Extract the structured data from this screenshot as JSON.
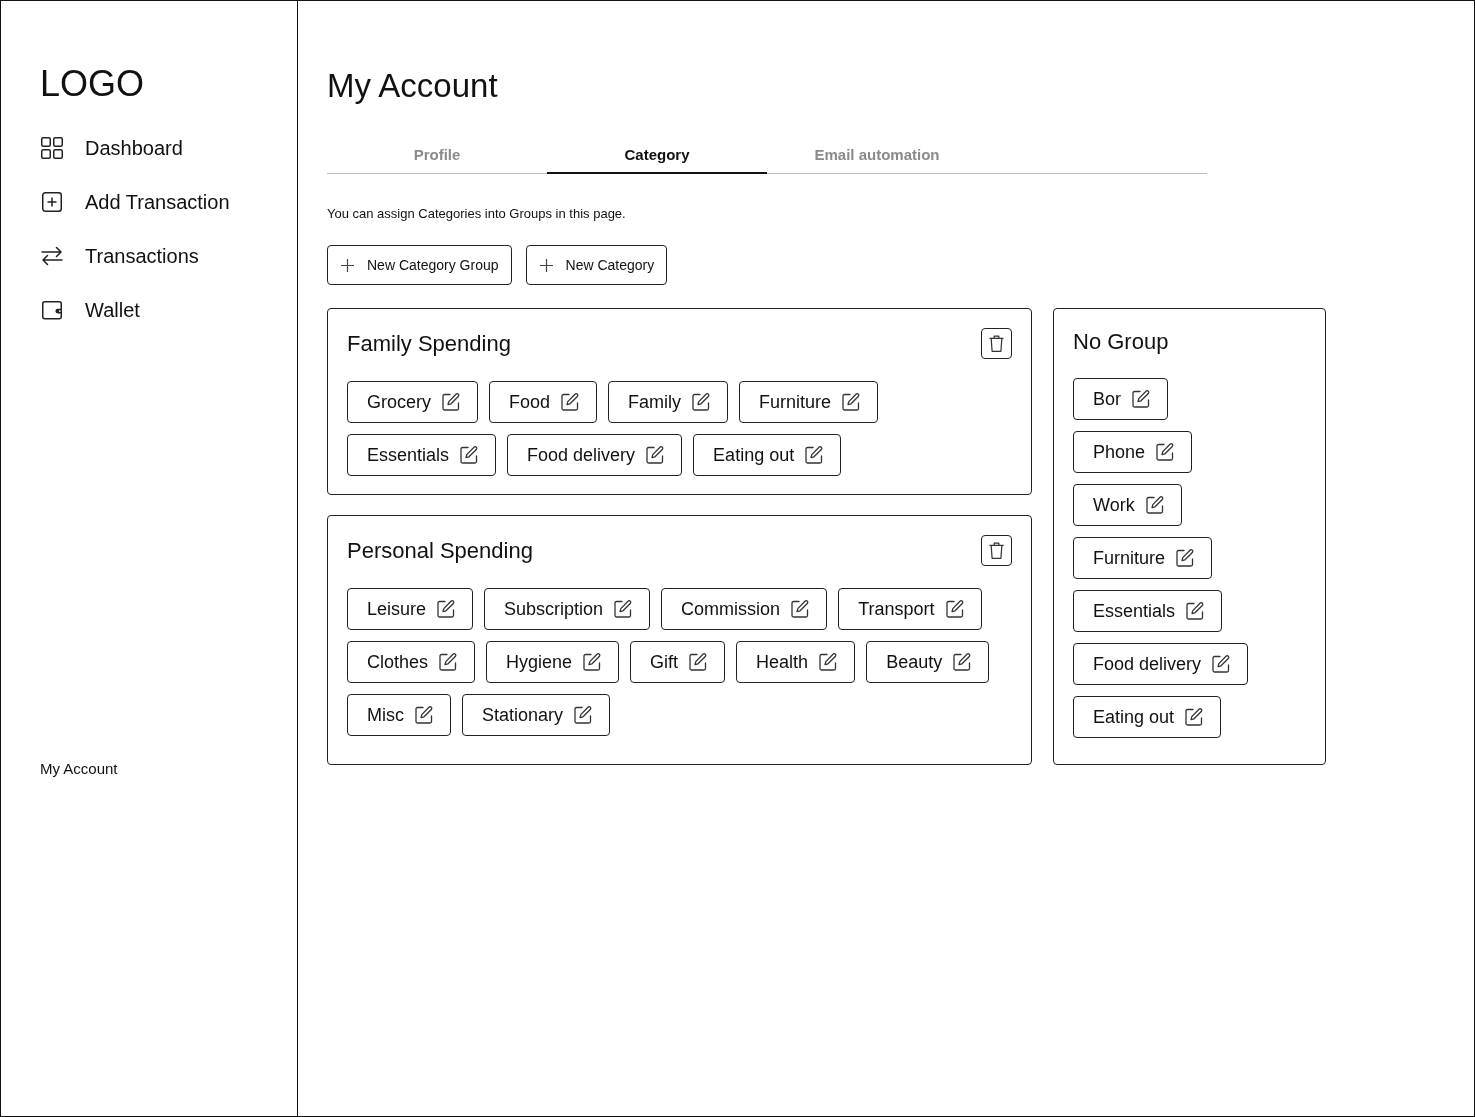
{
  "sidebar": {
    "logo": "LOGO",
    "items": [
      {
        "label": "Dashboard"
      },
      {
        "label": "Add Transaction"
      },
      {
        "label": "Transactions"
      },
      {
        "label": "Wallet"
      }
    ],
    "footer_link": "My Account"
  },
  "page": {
    "title": "My Account"
  },
  "tabs": [
    {
      "label": "Profile",
      "selected": false
    },
    {
      "label": "Category",
      "selected": true
    },
    {
      "label": "Email automation",
      "selected": false
    }
  ],
  "description": "You can assign Categories into Groups in this page.",
  "actions": [
    {
      "label": "New Category Group"
    },
    {
      "label": "New Category"
    }
  ],
  "groups": [
    {
      "name": "Family Spending",
      "kind": "group",
      "categories": [
        "Grocery",
        "Food",
        "Family",
        "Furniture",
        "Essentials",
        "Food delivery",
        "Eating out"
      ]
    },
    {
      "name": "Personal Spending",
      "kind": "group",
      "categories": [
        "Leisure",
        "Subscription",
        "Commission",
        "Transport",
        "Clothes",
        "Hygiene",
        "Gift",
        "Health",
        "Beauty",
        "Misc",
        "Stationary"
      ]
    },
    {
      "name": "No Group",
      "kind": "ungrouped",
      "categories": [
        "Bor",
        "Phone",
        "Work",
        "Furniture",
        "Essentials",
        "Food delivery",
        "Eating out"
      ]
    }
  ]
}
